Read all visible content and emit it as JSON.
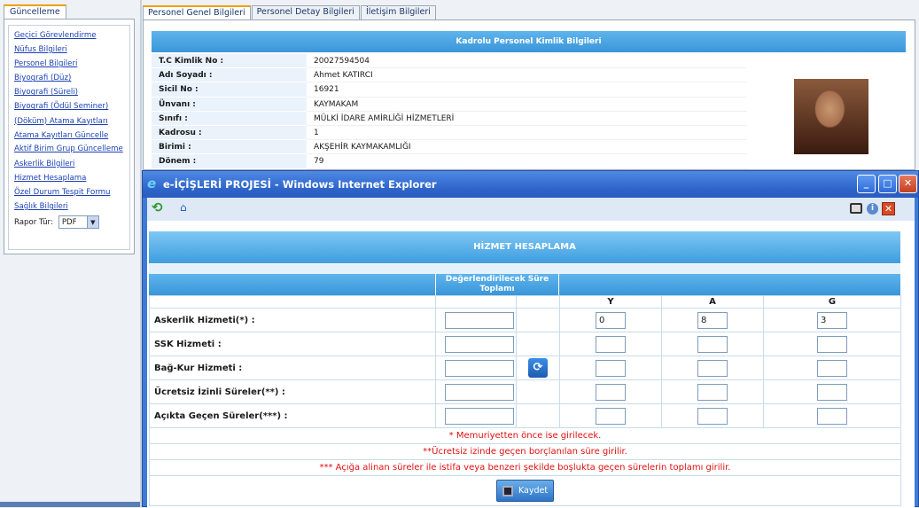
{
  "sidebar": {
    "tab_label": "Güncelleme",
    "links": [
      "Geçici Görevlendirme",
      "Nüfus Bilgileri",
      "Personel Bilgileri",
      "Biyografi (Düz)",
      "Biyografi (Süreli)",
      "Biyografi (Ödül Seminer)",
      "(Döküm) Atama Kayıtları",
      "Atama Kayıtları Güncelle",
      "Aktif Birim Grup Güncelleme",
      "Askerlik Bilgileri",
      "Hizmet Hesaplama",
      "Özel Durum Tespit Formu",
      "Sağlık Bilgileri"
    ],
    "rapor_label": "Rapor Tür:",
    "rapor_value": "PDF"
  },
  "main": {
    "tabs": [
      "Personel Genel Bilgileri",
      "Personel Detay Bilgileri",
      "İletişim Bilgileri"
    ],
    "card_title": "Kadrolu Personel Kimlik Bilgileri",
    "fields": [
      {
        "label": "T.C Kimlik No :",
        "value": "20027594504"
      },
      {
        "label": "Adı Soyadı :",
        "value": "Ahmet KATIRCI"
      },
      {
        "label": "Sicil No :",
        "value": "16921"
      },
      {
        "label": "Ünvanı :",
        "value": "KAYMAKAM"
      },
      {
        "label": "Sınıfı :",
        "value": "MÜLKİ İDARE AMİRLİĞİ HİZMETLERİ"
      },
      {
        "label": "Kadrosu :",
        "value": "1"
      },
      {
        "label": "Birimi :",
        "value": "AKŞEHİR KAYMAKAMLIĞI"
      },
      {
        "label": "Dönem :",
        "value": "79"
      }
    ]
  },
  "popup": {
    "window_title": "e-İÇİŞLERİ PROJESİ - Windows Internet Explorer",
    "ie_glyph": "e",
    "title": "HİZMET HESAPLAMA",
    "eval_header": "Değerlendirilecek Süre Toplamı",
    "col_y": "Y",
    "col_a": "A",
    "col_g": "G",
    "rows": [
      {
        "label": "Askerlik Hizmeti(*) :",
        "total": "",
        "y": "0",
        "a": "8",
        "g": "3"
      },
      {
        "label": "SSK Hizmeti :",
        "total": "",
        "y": "",
        "a": "",
        "g": ""
      },
      {
        "label": "Bağ-Kur Hizmeti :",
        "total": "",
        "y": "",
        "a": "",
        "g": ""
      },
      {
        "label": "Ücretsiz İzinli Süreler(**) :",
        "total": "",
        "y": "",
        "a": "",
        "g": ""
      },
      {
        "label": "Açıkta Geçen Süreler(***) :",
        "total": "",
        "y": "",
        "a": "",
        "g": ""
      }
    ],
    "notes": [
      "* Memuriyetten önce ise girilecek.",
      "**Ücretsiz izinde geçen borçlanılan süre girilir.",
      "*** Açığa alinan süreler ile istifa veya benzeri şekilde boşlukta geçen sürelerin toplamı girilir."
    ],
    "save_label": "Kaydet"
  },
  "colors": {
    "header_blue": "#3a96d8",
    "note_red": "#e01010",
    "titlebar_blue": "#2d63c8",
    "tab_accent": "#f0a000"
  },
  "icons": [
    "refresh-icon",
    "home-icon",
    "print-icon",
    "info-icon",
    "close-icon",
    "calculate-icon",
    "save-icon",
    "ie-logo-icon",
    "dropdown-arrow-icon"
  ]
}
